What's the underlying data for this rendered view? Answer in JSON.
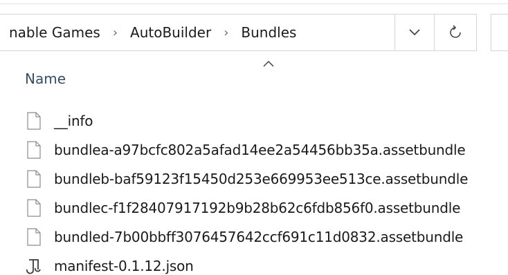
{
  "address_bar": {
    "crumbs": [
      "nable Games",
      "AutoBuilder",
      "Bundles"
    ]
  },
  "icons": {
    "dropdown": "chevron-down-icon",
    "refresh": "refresh-icon",
    "sort": "sort-ascending-icon",
    "file": "document-icon",
    "json": "json-file-icon"
  },
  "file_list": {
    "column_header": "Name",
    "files": [
      {
        "name": "__info",
        "type": "file"
      },
      {
        "name": "bundlea-a97bcfc802a5afad14ee2a54456bb35a.assetbundle",
        "type": "file"
      },
      {
        "name": "bundleb-baf59123f15450d253e669953ee513ce.assetbundle",
        "type": "file"
      },
      {
        "name": "bundlec-f1f28407917192b9b28b62c6fdb856f0.assetbundle",
        "type": "file"
      },
      {
        "name": "bundled-7b00bbff3076457642ccf691c11d0832.assetbundle",
        "type": "file"
      },
      {
        "name": "manifest-0.1.12.json",
        "type": "json"
      }
    ]
  },
  "colors": {
    "header_text": "#2f4f6f",
    "border": "#d4d4d4"
  }
}
